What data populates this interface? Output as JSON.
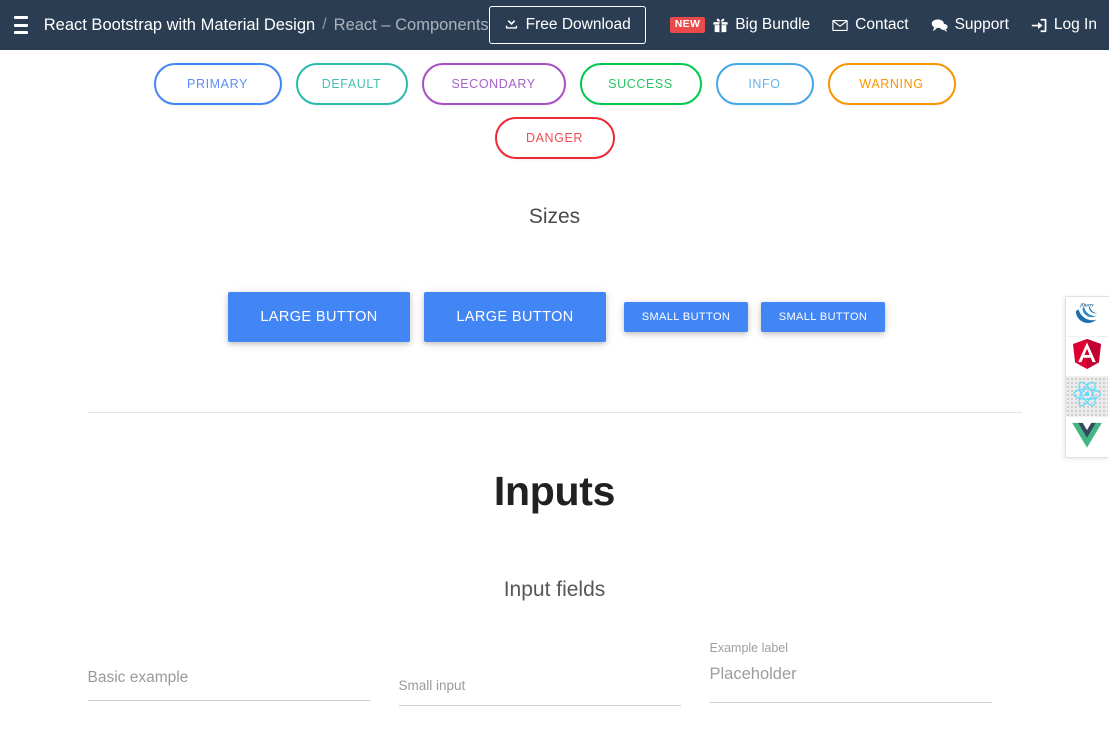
{
  "navbar": {
    "menu_icon": "hamburger-icon",
    "brand": "React Bootstrap with Material Design",
    "separator": "/",
    "breadcrumb": "React – Components",
    "download_button": "Free Download",
    "download_icon": "download-icon",
    "new_badge": "NEW",
    "links": [
      {
        "label": "Big Bundle",
        "icon": "gift-icon"
      },
      {
        "label": "Contact",
        "icon": "envelope-icon"
      },
      {
        "label": "Support",
        "icon": "chat-icon"
      },
      {
        "label": "Log In",
        "icon": "login-icon"
      }
    ],
    "background": "#2b3d52",
    "badge_color": "#e94b4b"
  },
  "outline_buttons": [
    {
      "label": "Primary",
      "color": "#4285f4"
    },
    {
      "label": "Default",
      "color": "#2bbbad"
    },
    {
      "label": "Secondary",
      "color": "#a74fc4"
    },
    {
      "label": "Success",
      "color": "#00c851"
    },
    {
      "label": "Info",
      "color": "#45a7e8"
    },
    {
      "label": "Warning",
      "color": "#f79400"
    },
    {
      "label": "Danger",
      "color": "#ec2a34"
    }
  ],
  "sizes": {
    "heading": "Sizes",
    "buttons": [
      {
        "label": "Large button",
        "size": "lg"
      },
      {
        "label": "Large button",
        "size": "lg"
      },
      {
        "label": "Small button",
        "size": "sm"
      },
      {
        "label": "Small button",
        "size": "sm"
      }
    ],
    "solid_color": "#4285f4"
  },
  "inputs": {
    "heading": "Inputs",
    "subheading": "Input fields",
    "fields": [
      {
        "placeholder": "Basic example",
        "label": ""
      },
      {
        "placeholder": "Small input",
        "label": ""
      },
      {
        "placeholder": "Placeholder",
        "label": "Example label"
      }
    ]
  },
  "tech_panel": {
    "items": [
      {
        "name": "jquery",
        "active": false
      },
      {
        "name": "angular",
        "active": false
      },
      {
        "name": "react",
        "active": true
      },
      {
        "name": "vue",
        "active": false
      }
    ]
  }
}
